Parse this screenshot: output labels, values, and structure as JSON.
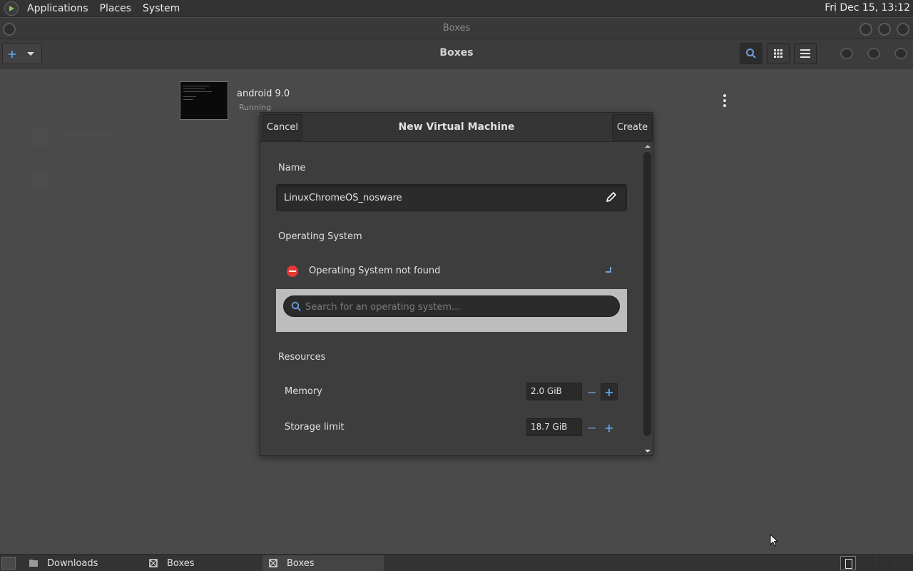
{
  "top_panel": {
    "menus": [
      "Applications",
      "Places",
      "System"
    ],
    "clock": "Fri Dec 15, 13:12"
  },
  "window": {
    "title": "Boxes",
    "header_title": "Boxes"
  },
  "machines": [
    {
      "name": "android 9.0",
      "status": "Running"
    }
  ],
  "dialog": {
    "title": "New Virtual Machine",
    "cancel_label": "Cancel",
    "create_label": "Create",
    "name_section": "Name",
    "name_value": "LinuxChromeOS_nosware",
    "os_section": "Operating System",
    "os_status": "Operating System not found",
    "os_search_placeholder": "Search for an operating system...",
    "resources_section": "Resources",
    "memory_label": "Memory",
    "memory_value": "2.0 GiB",
    "storage_label": "Storage limit",
    "storage_value": "18.7 GiB"
  },
  "taskbar": {
    "tasks": [
      "Downloads",
      "Boxes",
      "Boxes"
    ]
  },
  "colors": {
    "accent": "#5e9bd6",
    "error": "#e53935"
  }
}
